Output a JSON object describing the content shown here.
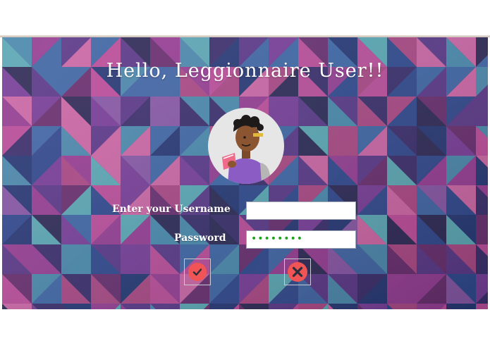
{
  "header": {
    "title": "Hello, Leggionnaire User!!"
  },
  "form": {
    "username_label": "Enter your Username",
    "password_label": "Password",
    "username_value": "",
    "password_masked": "••••••••"
  },
  "buttons": {
    "submit_icon": "check-icon",
    "cancel_icon": "close-icon"
  },
  "colors": {
    "submit": "#f05454",
    "cancel": "#f05454",
    "cancel_x": "#2a2f3d",
    "password_dots": "#1aa51a"
  }
}
